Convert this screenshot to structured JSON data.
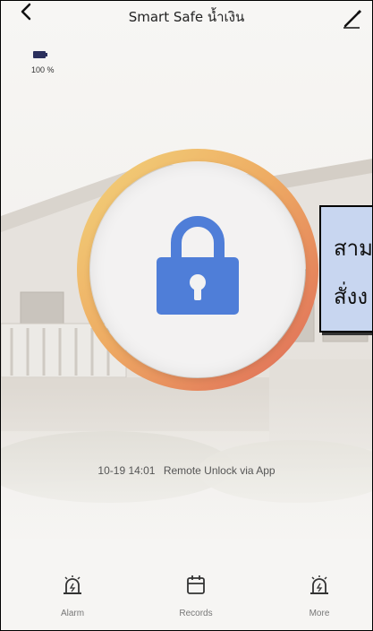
{
  "header": {
    "title": "Smart Safe น้ำเงิน",
    "back_icon": "chevron-left-icon",
    "edit_icon": "pencil-icon"
  },
  "battery": {
    "icon": "battery-icon",
    "level_percent": 100,
    "label": "100 %"
  },
  "lock": {
    "icon": "lock-icon",
    "state": "locked",
    "colors": {
      "lock": "#4f7ed8",
      "ring_start": "#f0c66a",
      "ring_end": "#e0705a"
    }
  },
  "callout": {
    "line1": "สาม",
    "line2": "สั่งง"
  },
  "status": {
    "time": "10-19 14:01",
    "message": "Remote Unlock via App"
  },
  "tabs": [
    {
      "label": "Alarm",
      "icon": "alarm-siren-icon"
    },
    {
      "label": "Records",
      "icon": "calendar-icon"
    },
    {
      "label": "More",
      "icon": "alarm-siren-icon"
    }
  ]
}
